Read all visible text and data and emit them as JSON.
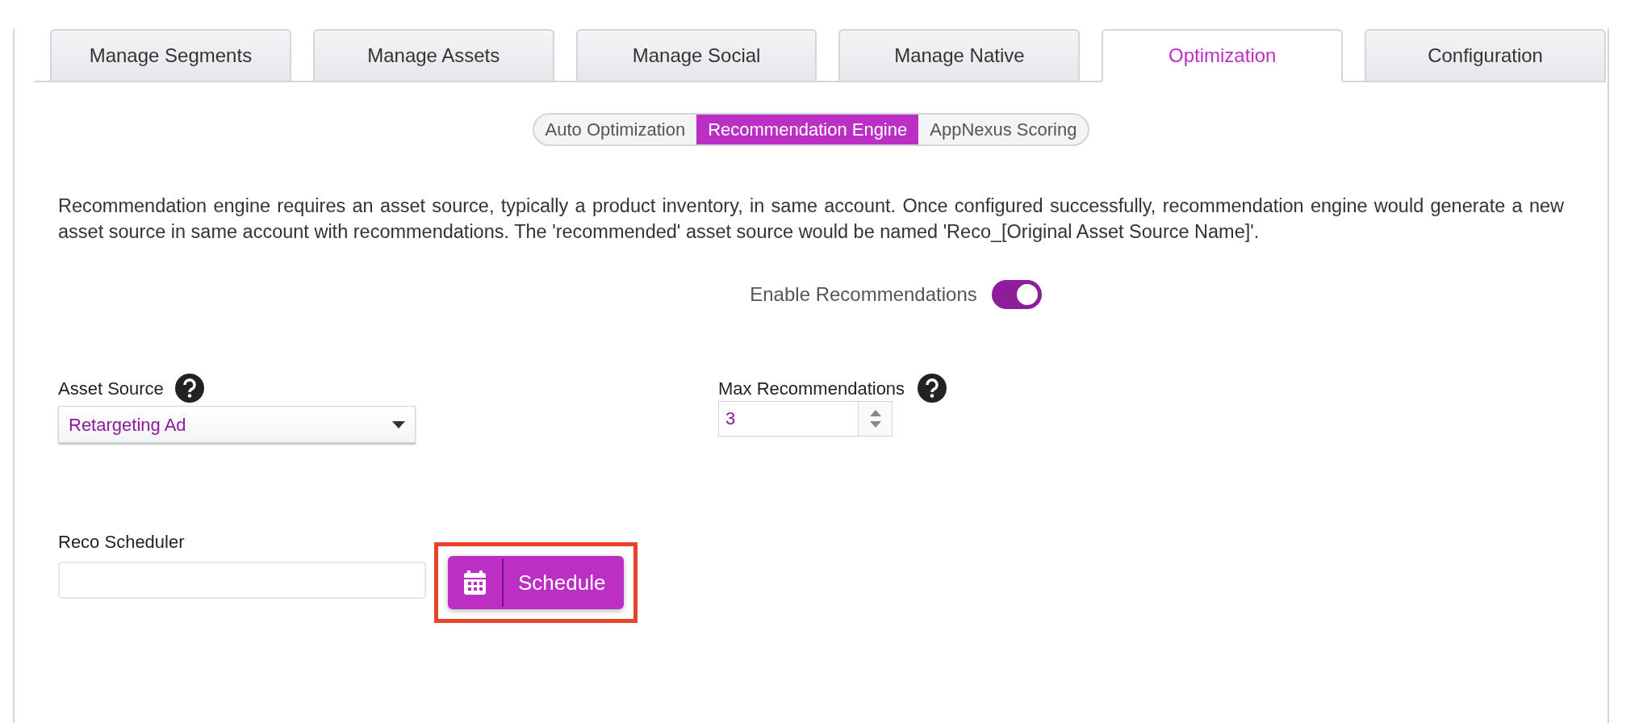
{
  "tabs": [
    {
      "label": "Manage Segments",
      "selected": false
    },
    {
      "label": "Manage Assets",
      "selected": false
    },
    {
      "label": "Manage Social",
      "selected": false
    },
    {
      "label": "Manage Native",
      "selected": false
    },
    {
      "label": "Optimization",
      "selected": true
    },
    {
      "label": "Configuration",
      "selected": false
    }
  ],
  "subtabs": [
    {
      "label": "Auto Optimization",
      "selected": false
    },
    {
      "label": "Recommendation Engine",
      "selected": true
    },
    {
      "label": "AppNexus Scoring",
      "selected": false
    }
  ],
  "description": "Recommendation engine requires an asset source, typically a product inventory, in same account. Once configured successfully, recommendation engine would generate a new asset source in same account with recommendations. The 'recommended' asset source would be named 'Reco_[Original Asset Source Name]'.",
  "enable_toggle": {
    "label": "Enable Recommendations",
    "on": true
  },
  "asset_source": {
    "label": "Asset Source",
    "value": "Retargeting Ad"
  },
  "max_recommendations": {
    "label": "Max Recommendations",
    "value": "3"
  },
  "reco_scheduler": {
    "label": "Reco Scheduler",
    "button": {
      "label": "Schedule",
      "highlighted": true
    }
  }
}
